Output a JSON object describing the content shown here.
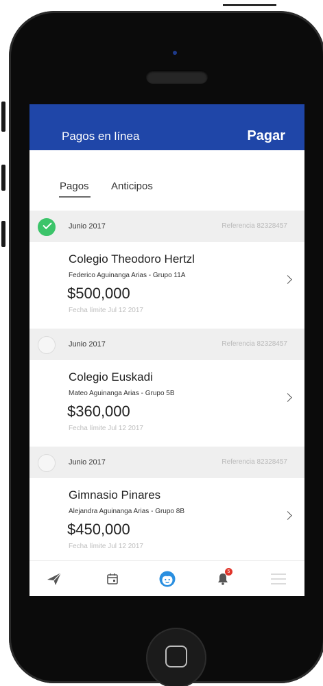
{
  "header": {
    "title": "Pagos en línea",
    "action": "Pagar"
  },
  "tabs": [
    {
      "label": "Pagos",
      "active": true
    },
    {
      "label": "Anticipos",
      "active": false
    }
  ],
  "payments": [
    {
      "month": "Junio 2017",
      "reference": "Referencia 82328457",
      "selected": true,
      "school": "Colegio Theodoro Hertzl",
      "student": "Federico Aguinanga Arias - Grupo 11A",
      "amount": "$500,000",
      "due": "Fecha límite Jul 12 2017"
    },
    {
      "month": "Junio 2017",
      "reference": "Referencia 82328457",
      "selected": false,
      "school": "Colegio Euskadi",
      "student": "Mateo Aguinanga Arias - Grupo 5B",
      "amount": "$360,000",
      "due": "Fecha límite Jul 12 2017"
    },
    {
      "month": "Junio 2017",
      "reference": "Referencia 82328457",
      "selected": false,
      "school": "Gimnasio Pinares",
      "student": "Alejandra Aguinanga Arias - Grupo 8B",
      "amount": "$450,000",
      "due": "Fecha límite Jul 12 2017"
    }
  ],
  "tabbar": {
    "notification_count": "5",
    "icons": [
      "send-icon",
      "calendar-icon",
      "child-face-icon",
      "bell-icon",
      "menu-icon"
    ]
  },
  "colors": {
    "header": "#1f46a8",
    "selected": "#3cc46a",
    "active_tab_icon": "#2a8fe0",
    "badge": "#e0352b"
  }
}
